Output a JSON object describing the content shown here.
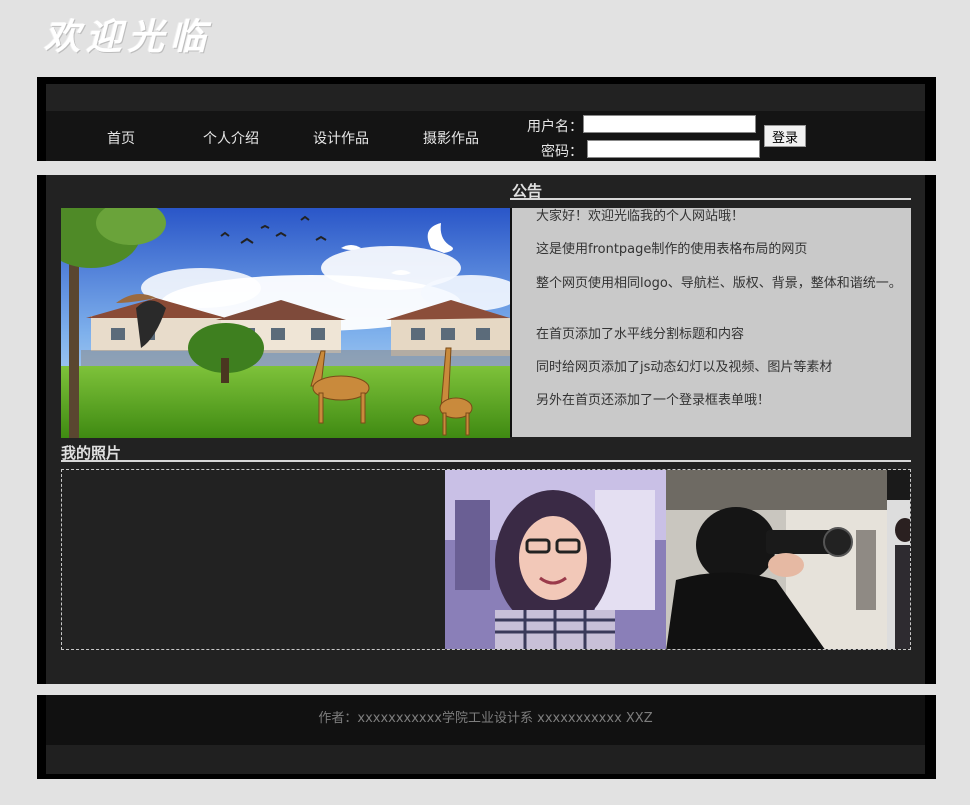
{
  "logo_text": "欢迎光临",
  "nav": {
    "items": [
      "首页",
      "个人介绍",
      "设计作品",
      "摄影作品"
    ],
    "username_label": "用户名：",
    "password_label": "密码：",
    "username_value": "",
    "password_value": "",
    "login_label": "登录"
  },
  "notice": {
    "title": "公告",
    "lines": [
      "大家好！欢迎光临我的个人网站哦！",
      "这是使用frontpage制作的使用表格布局的网页",
      "整个网页使用相同logo、导航栏、版权、背景，整体和谐统一。",
      "在首页添加了水平线分割标题和内容",
      "同时给网页添加了js动态幻灯以及视频、图片等素材",
      "另外在首页还添加了一个登录框表单哦！"
    ]
  },
  "photos": {
    "title": "我的照片"
  },
  "footer": {
    "text": "作者：xxxxxxxxxxx学院工业设计系 xxxxxxxxxxx XXZ"
  },
  "colors": {
    "page_bg": "#e2e2e2",
    "panel_bg": "#222222",
    "notice_bg": "#c9c9c9"
  }
}
